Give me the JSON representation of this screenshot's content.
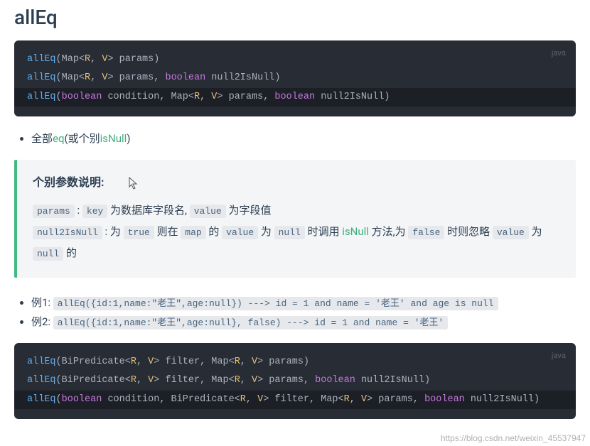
{
  "title": "allEq",
  "code1_lang": "java",
  "code1": {
    "l1_fn": "allEq",
    "l1_open": "(Map<",
    "l1_R": "R",
    "l1_c1": ", ",
    "l1_V": "V",
    "l1_close": "> params)",
    "l2_fn": "allEq",
    "l2_open": "(Map<",
    "l2_R": "R",
    "l2_c1": ", ",
    "l2_V": "V",
    "l2_mid": "> params, ",
    "l2_kw": "boolean",
    "l2_tail": " null2IsNull)",
    "l3_fn": "allEq",
    "l3_open": "(",
    "l3_kw1": "boolean",
    "l3_a": " condition, Map<",
    "l3_R": "R",
    "l3_c1": ", ",
    "l3_V": "V",
    "l3_b": "> params, ",
    "l3_kw2": "boolean",
    "l3_tail": " null2IsNull)"
  },
  "bullet1": {
    "t1": "全部",
    "link1": "eq",
    "t2": "(或个别",
    "link2": "isNull",
    "t3": ")"
  },
  "infobox": {
    "heading": "个别参数说明:",
    "p1": {
      "c1": "params",
      "t1": " : ",
      "c2": "key",
      "t2": " 为数据库字段名, ",
      "c3": "value",
      "t3": " 为字段值"
    },
    "p2": {
      "c1": "null2IsNull",
      "t1": " : 为 ",
      "c2": "true",
      "t2": " 则在 ",
      "c3": "map",
      "t3": " 的 ",
      "c4": "value",
      "t4": " 为 ",
      "c5": "null",
      "t5": " 时调用 ",
      "link": "isNull",
      "t6": " 方法,为 ",
      "c6": "false",
      "t7": " 时则忽略 ",
      "c7": "value",
      "t8": " 为 ",
      "c8": "null",
      "t9": " 的"
    }
  },
  "examples": {
    "e1_label": "例1: ",
    "e1_code": "allEq({id:1,name:\"老王\",age:null})",
    "e1_arrow": " ---> ",
    "e1_result": "id = 1 and name = '老王' and age is null",
    "e2_label": "例2: ",
    "e2_code": "allEq({id:1,name:\"老王\",age:null}, false)",
    "e2_arrow": " ---> ",
    "e2_result": "id = 1 and name = '老王'"
  },
  "code2_lang": "java",
  "code2": {
    "l1_fn": "allEq",
    "l1_a": "(BiPredicate<",
    "l1_R": "R",
    "l1_c1": ", ",
    "l1_V": "V",
    "l1_b": "> filter, Map<",
    "l1_R2": "R",
    "l1_c2": ", ",
    "l1_V2": "V",
    "l1_tail": "> params)",
    "l2_fn": "allEq",
    "l2_a": "(BiPredicate<",
    "l2_R": "R",
    "l2_c1": ", ",
    "l2_V": "V",
    "l2_b": "> filter, Map<",
    "l2_R2": "R",
    "l2_c2": ", ",
    "l2_V2": "V",
    "l2_mid": "> params, ",
    "l2_kw": "boolean",
    "l2_tail": " null2IsNull)",
    "l3_fn": "allEq",
    "l3_open": "(",
    "l3_kw1": "boolean",
    "l3_a": " condition, BiPredicate<",
    "l3_R": "R",
    "l3_c1": ", ",
    "l3_V": "V",
    "l3_b": "> filter, Map<",
    "l3_R2": "R",
    "l3_c2": ", ",
    "l3_V2": "V",
    "l3_mid": "> params, ",
    "l3_kw2": "boolean",
    "l3_tail": " null2IsNull)"
  },
  "watermark": "https://blog.csdn.net/weixin_45537947"
}
